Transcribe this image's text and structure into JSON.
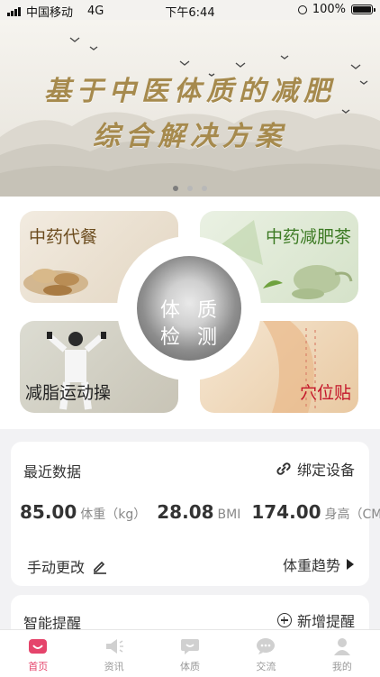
{
  "status_bar": {
    "carrier": "中国移动",
    "network": "4G",
    "time": "下午6:44",
    "battery": "100%",
    "battery_level": 1.0
  },
  "banner": {
    "line1": "基于中医体质的减肥",
    "line2": "综合解决方案",
    "page_count": 3,
    "active_page": 1
  },
  "features": {
    "meal": "中药代餐",
    "tea": "中药减肥茶",
    "exercise": "减脂运动操",
    "acupoint": "穴位贴",
    "center_line1": "体 质",
    "center_line2": "检 测"
  },
  "recent_data": {
    "title": "最近数据",
    "bind_device": "绑定设备",
    "weight_value": "85.00",
    "weight_unit": "体重（kg）",
    "bmi_value": "28.08",
    "bmi_unit": "BMI",
    "height_value": "174.00",
    "height_unit": "身高（CM）",
    "manual_edit": "手动更改",
    "trend": "体重趋势"
  },
  "reminder": {
    "title": "智能提醒",
    "add": "新增提醒"
  },
  "tabs": [
    {
      "label": "首页",
      "icon": "home-icon",
      "active": true
    },
    {
      "label": "资讯",
      "icon": "news-icon",
      "active": false
    },
    {
      "label": "体质",
      "icon": "constitution-icon",
      "active": false
    },
    {
      "label": "交流",
      "icon": "chat-icon",
      "active": false
    },
    {
      "label": "我的",
      "icon": "profile-icon",
      "active": false
    }
  ],
  "colors": {
    "accent": "#e5446b",
    "banner_text": "#a68a4d",
    "tea_text": "#3c7a23",
    "acupoint_text": "#c4162a"
  }
}
